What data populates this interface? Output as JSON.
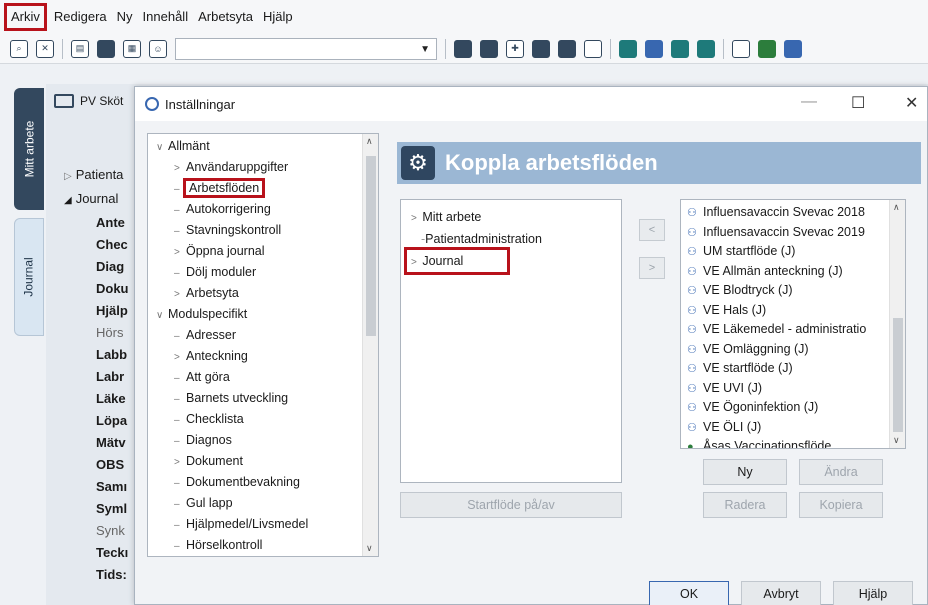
{
  "menubar": {
    "items": [
      "Arkiv",
      "Redigera",
      "Ny",
      "Innehåll",
      "Arbetsyta",
      "Hjälp"
    ]
  },
  "left_tabs": [
    "Mitt arbete",
    "Journal"
  ],
  "background": {
    "panel_title": "PV Sköt",
    "tree": {
      "patient": "Patienta",
      "journal": "Journal",
      "items": [
        "Ante",
        "Chec",
        "Diag",
        "Doku",
        "Hjälp",
        "Hörs",
        "Labb",
        "Labr",
        "Läke",
        "Löpa",
        "Mätv",
        "OBS",
        "Samı",
        "Syml",
        "Synk",
        "Teckı",
        "Tids:"
      ]
    }
  },
  "dialog": {
    "title": "Inställningar",
    "settings_tree": [
      {
        "label": "Allmänt",
        "level": 0,
        "arrow": "∨"
      },
      {
        "label": "Användaruppgifter",
        "level": 1,
        "arrow": ">"
      },
      {
        "label": "Arbetsflöden",
        "level": 1,
        "arrow": ""
      },
      {
        "label": "Autokorrigering",
        "level": 1,
        "arrow": ""
      },
      {
        "label": "Stavningskontroll",
        "level": 1,
        "arrow": ""
      },
      {
        "label": "Öppna journal",
        "level": 1,
        "arrow": ">"
      },
      {
        "label": "Dölj moduler",
        "level": 1,
        "arrow": ""
      },
      {
        "label": "Arbetsyta",
        "level": 1,
        "arrow": ">"
      },
      {
        "label": "Modulspecifikt",
        "level": 0,
        "arrow": "∨"
      },
      {
        "label": "Adresser",
        "level": 1,
        "arrow": ""
      },
      {
        "label": "Anteckning",
        "level": 1,
        "arrow": ">"
      },
      {
        "label": "Att göra",
        "level": 1,
        "arrow": ""
      },
      {
        "label": "Barnets utveckling",
        "level": 1,
        "arrow": ""
      },
      {
        "label": "Checklista",
        "level": 1,
        "arrow": ""
      },
      {
        "label": "Diagnos",
        "level": 1,
        "arrow": ""
      },
      {
        "label": "Dokument",
        "level": 1,
        "arrow": ">"
      },
      {
        "label": "Dokumentbevakning",
        "level": 1,
        "arrow": ""
      },
      {
        "label": "Gul lapp",
        "level": 1,
        "arrow": ""
      },
      {
        "label": "Hjälpmedel/Livsmedel",
        "level": 1,
        "arrow": ""
      },
      {
        "label": "Hörselkontroll",
        "level": 1,
        "arrow": ""
      }
    ],
    "header": "Koppla arbetsflöden",
    "flow_targets": [
      "Mitt arbete",
      "Patientadministration",
      "Journal"
    ],
    "move_left": "<",
    "move_right": ">",
    "workflows": [
      {
        "label": "Influensavaccin Svevac 2018",
        "icon": "group"
      },
      {
        "label": "Influensavaccin Svevac 2019",
        "icon": "group"
      },
      {
        "label": "UM startflöde (J)",
        "icon": "group"
      },
      {
        "label": "VE Allmän anteckning (J)",
        "icon": "group"
      },
      {
        "label": "VE Blodtryck (J)",
        "icon": "group"
      },
      {
        "label": "VE Hals (J)",
        "icon": "group"
      },
      {
        "label": "VE Läkemedel - administratio",
        "icon": "group"
      },
      {
        "label": "VE Omläggning (J)",
        "icon": "group"
      },
      {
        "label": "VE startflöde (J)",
        "icon": "group"
      },
      {
        "label": "VE UVI (J)",
        "icon": "group"
      },
      {
        "label": "VE Ögoninfektion (J)",
        "icon": "group"
      },
      {
        "label": "VE ÖLI (J)",
        "icon": "group"
      },
      {
        "label": "Åsas Vaccinationsflöde",
        "icon": "single"
      }
    ],
    "buttons": {
      "startflode": "Startflöde på/av",
      "ny": "Ny",
      "andra": "Ändra",
      "radera": "Radera",
      "kopiera": "Kopiera",
      "ok": "OK",
      "avbryt": "Avbryt",
      "hjalp": "Hjälp"
    },
    "window_controls": {
      "minimize": "—",
      "maximize": "☐",
      "close": "✕"
    }
  },
  "colors": {
    "highlight_box": "#b8121b",
    "header_band": "#9bb7d4",
    "dark_navy": "#33485e"
  }
}
